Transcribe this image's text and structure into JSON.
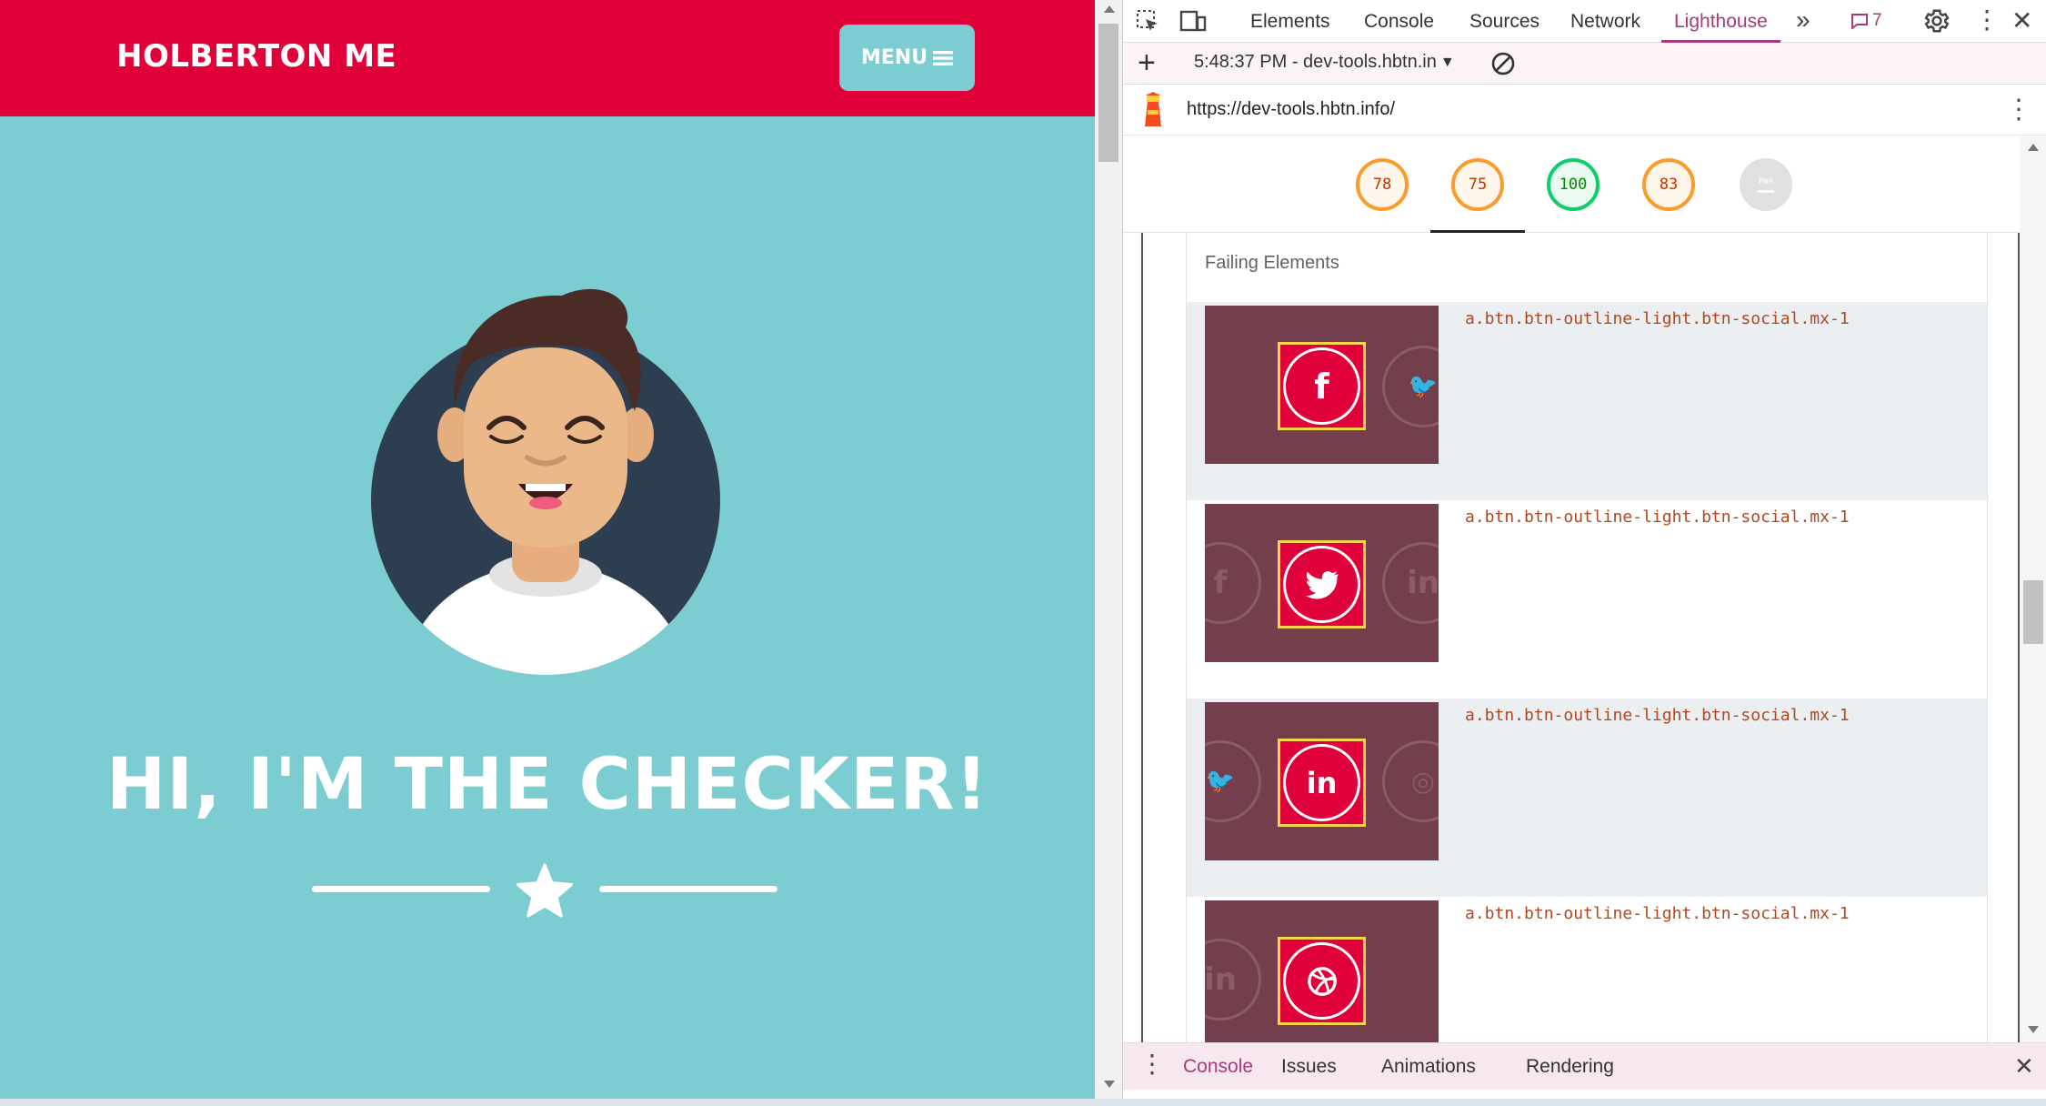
{
  "site": {
    "brand": "HOLBERTON ME",
    "menu_label": "MENU",
    "hero_title": "HI, I'M THE CHECKER!"
  },
  "devtools": {
    "tabs": [
      "Elements",
      "Console",
      "Sources",
      "Network",
      "Lighthouse"
    ],
    "active_tab": "Lighthouse",
    "issues_count": "7",
    "report_selector_text": "5:48:37 PM - dev-tools.hbtn.in",
    "url": "https://dev-tools.hbtn.info/",
    "scores": [
      "78",
      "75",
      "100",
      "83"
    ],
    "pwa_label": "PWA",
    "failing_header": "Failing Elements",
    "failing_rows": [
      {
        "selector": "a.btn.btn-outline-light.btn-social.mx-1",
        "highlight": "f"
      },
      {
        "selector": "a.btn.btn-outline-light.btn-social.mx-1",
        "highlight": "twitter"
      },
      {
        "selector": "a.btn.btn-outline-light.btn-social.mx-1",
        "highlight": "in"
      },
      {
        "selector": "a.btn.btn-outline-light.btn-social.mx-1",
        "highlight": "dribbble"
      }
    ],
    "drawer_tabs": [
      "Console",
      "Issues",
      "Animations",
      "Rendering"
    ]
  },
  "colors": {
    "brand_red": "#e0003a",
    "teal": "#7bcdd1",
    "devtools_accent": "#a83a7a",
    "score_orange": "#fa9b2b",
    "score_green": "#0cce6b"
  }
}
